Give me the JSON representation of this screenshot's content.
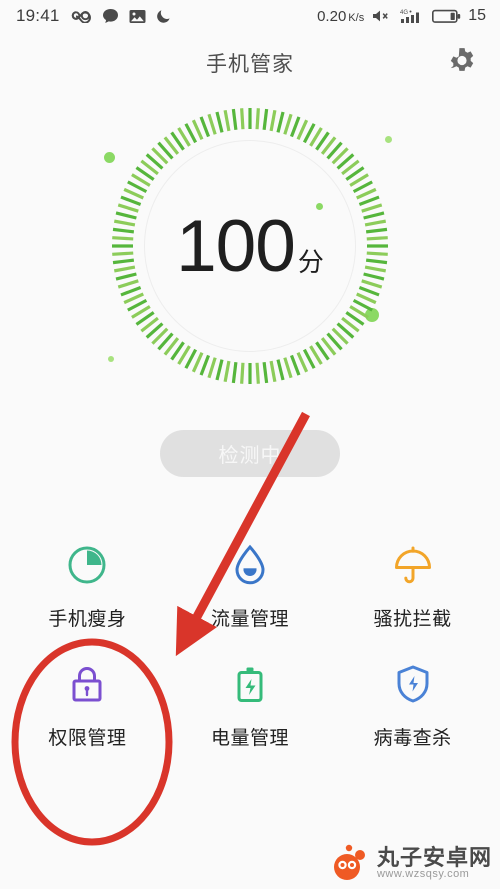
{
  "status_bar": {
    "time": "19:41",
    "left_icons": [
      "infinity-icon",
      "chat-bubble-icon",
      "image-icon",
      "moon-icon"
    ],
    "network_speed": "0.20",
    "network_speed_unit": "K/s",
    "volume_icon": "mute-speaker-icon",
    "signal_label": "4G",
    "battery_percent": "15"
  },
  "header": {
    "title": "手机管家",
    "settings_icon": "gear-icon"
  },
  "gauge": {
    "score": "100",
    "unit": "分",
    "ring_color": "#56b63c",
    "ring_color_light": "#8ccc5a",
    "dot_color": "#8bd964"
  },
  "detect_button": {
    "label": "检测中"
  },
  "features": {
    "rows": [
      [
        {
          "label": "手机瘦身",
          "icon": "pie-chart-icon",
          "color": "#3fb68b"
        },
        {
          "label": "流量管理",
          "icon": "water-drop-icon",
          "color": "#3a76c8"
        },
        {
          "label": "骚扰拦截",
          "icon": "umbrella-icon",
          "color": "#f2a529"
        }
      ],
      [
        {
          "label": "权限管理",
          "icon": "lock-icon",
          "color": "#7b4fd0"
        },
        {
          "label": "电量管理",
          "icon": "battery-icon",
          "color": "#35bb7a"
        },
        {
          "label": "病毒查杀",
          "icon": "shield-icon",
          "color": "#4a82d6"
        }
      ]
    ]
  },
  "annotations": {
    "arrow_color": "#d9352a",
    "ellipse_color": "#d9352a",
    "arrow_target": "流量管理",
    "ellipse_target": "权限管理"
  },
  "watermark": {
    "name": "丸子安卓网",
    "url": "www.wzsqsy.com",
    "logo_color": "#ef5a24"
  }
}
